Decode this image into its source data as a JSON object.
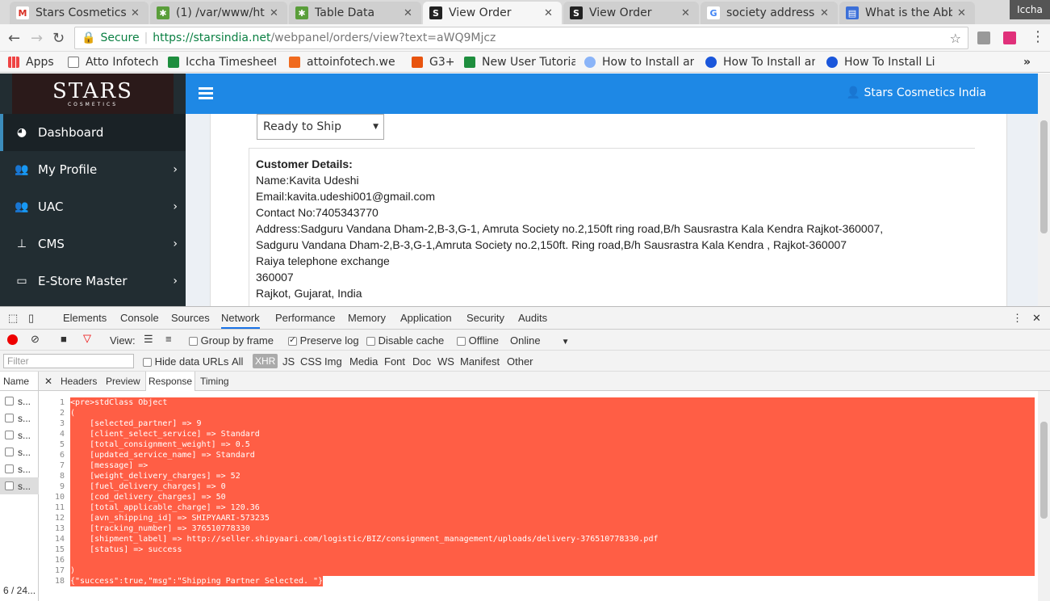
{
  "browser": {
    "tabs": [
      {
        "label": "Stars Cosmetics",
        "icon": "gmail-icon"
      },
      {
        "label": "(1) /var/www/ht",
        "icon": "bug-icon"
      },
      {
        "label": "Table Data",
        "icon": "bug-icon"
      },
      {
        "label": "View Order",
        "icon": "s-logo-icon"
      },
      {
        "label": "View Order",
        "icon": "s-logo-icon"
      },
      {
        "label": "society address",
        "icon": "google-icon"
      },
      {
        "label": "What is the Abb",
        "icon": "doc-icon"
      }
    ],
    "window_user": "Iccha",
    "secure_label": "Secure",
    "url_host": "https://starsindia.net",
    "url_path": "/webpanel/orders/view?text=aWQ9Mjcz",
    "bookmarks": [
      "Apps",
      "Atto Infotech",
      "Iccha Timesheet",
      "attoinfotech.we",
      "G3+",
      "New User Tutoria",
      "How to Install an",
      "How To Install an",
      "How To Install Li"
    ]
  },
  "page": {
    "logo_big": "STARS",
    "logo_small": "COSMETICS",
    "sidebar": [
      {
        "label": "Dashboard",
        "icon": "dashboard-icon",
        "active": true
      },
      {
        "label": "My Profile",
        "icon": "users-icon"
      },
      {
        "label": "UAC",
        "icon": "users-icon"
      },
      {
        "label": "CMS",
        "icon": "sitemap-icon"
      },
      {
        "label": "E-Store Master",
        "icon": "laptop-icon"
      }
    ],
    "user_name": "Stars Cosmetics India",
    "status_value": "Ready to Ship",
    "customer": {
      "heading": "Customer Details:",
      "name": "Name:Kavita Udeshi",
      "email": "Email:kavita.udeshi001@gmail.com",
      "contact": "Contact No:7405343770",
      "address1": "Address:Sadguru Vandana Dham-2,B-3,G-1, Amruta Society no.2,150ft ring road,B/h Sausrastra Kala Kendra Rajkot-360007,",
      "address2": "Sadguru Vandana Dham-2,B-3,G-1,Amruta Society no.2,150ft. Ring road,B/h Sausrastra Kala Kendra , Rajkot-360007",
      "address3": "Raiya telephone exchange",
      "pin": "360007",
      "city": "Rajkot, Gujarat, India"
    }
  },
  "devtools": {
    "tabs": [
      "Elements",
      "Console",
      "Sources",
      "Network",
      "Performance",
      "Memory",
      "Application",
      "Security",
      "Audits"
    ],
    "active_tab": "Network",
    "view_label": "View:",
    "group_by_frame": "Group by frame",
    "preserve_log": "Preserve log",
    "disable_cache": "Disable cache",
    "offline": "Offline",
    "throttle": "Online",
    "filter_placeholder": "Filter",
    "hide_data_urls": "Hide data URLs",
    "type_filters": [
      "All",
      "XHR",
      "JS",
      "CSS",
      "Img",
      "Media",
      "Font",
      "Doc",
      "WS",
      "Manifest",
      "Other"
    ],
    "name_header": "Name",
    "requests": [
      "s...",
      "s...",
      "s...",
      "s...",
      "s...",
      "s..."
    ],
    "request_count": "6 / 24...",
    "detail_tabs": [
      "Headers",
      "Preview",
      "Response",
      "Timing"
    ],
    "response_lines": [
      "<pre>stdClass Object",
      "(",
      "    [selected_partner] => 9",
      "    [client_select_service] => Standard",
      "    [total_consignment_weight] => 0.5",
      "    [updated_service_name] => Standard",
      "    [message] => ",
      "    [weight_delivery_charges] => 52",
      "    [fuel_delivery_charges] => 0",
      "    [cod_delivery_charges] => 50",
      "    [total_applicable_charge] => 120.36",
      "    [avn_shipping_id] => SHIPYAARI-573235",
      "    [tracking_number] => 376510778330",
      "    [shipment_label] => http://seller.shipyaari.com/logistic/BIZ/consignment_management/uploads/delivery-376510778330.pdf",
      "    [status] => success",
      "",
      ")",
      "{\"success\":true,\"msg\":\"Shipping Partner Selected. \"}"
    ]
  }
}
